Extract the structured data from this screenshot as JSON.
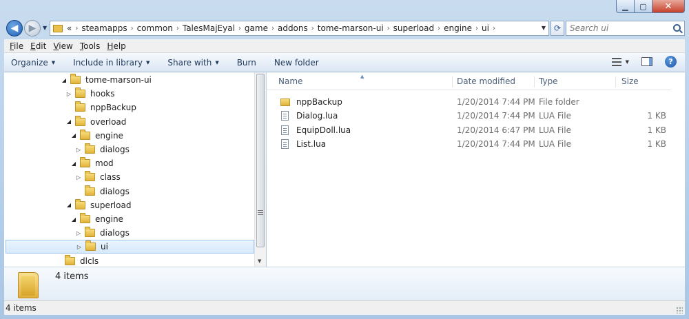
{
  "address": {
    "prefix": "«",
    "crumbs": [
      "steamapps",
      "common",
      "TalesMajEyal",
      "game",
      "addons",
      "tome-marson-ui",
      "superload",
      "engine",
      "ui"
    ]
  },
  "search": {
    "placeholder": "Search ui"
  },
  "menu": [
    "File",
    "Edit",
    "View",
    "Tools",
    "Help"
  ],
  "toolbar": {
    "organize": "Organize",
    "include": "Include in library",
    "share": "Share with",
    "burn": "Burn",
    "new_folder": "New folder"
  },
  "tree": [
    {
      "label": "tome-marson-ui",
      "expander": "open",
      "level": 0
    },
    {
      "label": "hooks",
      "expander": "closed",
      "level": 1
    },
    {
      "label": "nppBackup",
      "expander": "none",
      "level": 1
    },
    {
      "label": "overload",
      "expander": "open",
      "level": 1
    },
    {
      "label": "engine",
      "expander": "open",
      "level": 2
    },
    {
      "label": "dialogs",
      "expander": "closed",
      "level": 3
    },
    {
      "label": "mod",
      "expander": "open",
      "level": 2
    },
    {
      "label": "class",
      "expander": "closed",
      "level": 3
    },
    {
      "label": "dialogs",
      "expander": "none",
      "level": 3
    },
    {
      "label": "superload",
      "expander": "open",
      "level": 1
    },
    {
      "label": "engine",
      "expander": "open",
      "level": 2
    },
    {
      "label": "dialogs",
      "expander": "closed",
      "level": 3
    },
    {
      "label": "ui",
      "expander": "closed",
      "level": 3,
      "selected": true
    },
    {
      "label": "dlcls",
      "expander": "none",
      "level": -1
    }
  ],
  "columns": {
    "name": "Name",
    "date": "Date modified",
    "type": "Type",
    "size": "Size"
  },
  "files": [
    {
      "name": "nppBackup",
      "date": "1/20/2014 7:44 PM",
      "type": "File folder",
      "size": "",
      "icon": "folder-icon"
    },
    {
      "name": "Dialog.lua",
      "date": "1/20/2014 7:44 PM",
      "type": "LUA File",
      "size": "1 KB",
      "icon": "lua-file-icon"
    },
    {
      "name": "EquipDoll.lua",
      "date": "1/20/2014 6:47 PM",
      "type": "LUA File",
      "size": "1 KB",
      "icon": "lua-file-icon"
    },
    {
      "name": "List.lua",
      "date": "1/20/2014 7:44 PM",
      "type": "LUA File",
      "size": "1 KB",
      "icon": "lua-file-icon"
    }
  ],
  "details": {
    "count": "4 items"
  },
  "status": {
    "text": "4 items"
  }
}
